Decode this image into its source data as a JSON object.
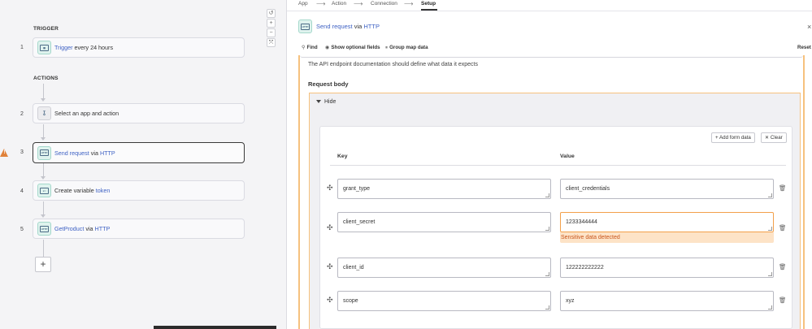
{
  "breadcrumbs": [
    "App",
    "Action",
    "Connection",
    "Setup"
  ],
  "flow": {
    "trigger_label": "TRIGGER",
    "actions_label": "ACTIONS",
    "steps": [
      {
        "num": "1",
        "prefix": "Trigger",
        "suffix": " every 24 hours",
        "icon": "calendar-icon"
      },
      {
        "num": "2",
        "prefix": "",
        "suffix": "Select an app and action",
        "icon": "action-icon"
      },
      {
        "num": "3",
        "prefix": "Send request",
        "suffix": " via ",
        "tail": "HTTP",
        "icon": "http-icon",
        "warning": true
      },
      {
        "num": "4",
        "prefix": "",
        "suffix": "Create variable ",
        "tail": "token",
        "icon": "variable-icon"
      },
      {
        "num": "5",
        "prefix": "GetProduct",
        "suffix": " via ",
        "tail": "HTTP",
        "icon": "http-icon"
      }
    ],
    "add_step": "+",
    "zoom_controls": [
      "↺",
      "+",
      "−",
      "⤧"
    ]
  },
  "panel": {
    "title_prefix": "Send request",
    "title_middle": " via ",
    "title_tail": "HTTP",
    "close": "×",
    "toolbar": {
      "find": "Find",
      "optional": "Show optional fields",
      "group": "Group map data",
      "reset": "Reset"
    },
    "hint": "The API endpoint documentation should define what data it expects",
    "section_title": "Request body",
    "hide_label": "Hide",
    "add_form_data": "Add form data",
    "clear": "Clear",
    "key_header": "Key",
    "value_header": "Value",
    "rows": [
      {
        "key": "grant_type",
        "value": "client_credentials"
      },
      {
        "key": "client_secret",
        "value": "1233344444",
        "warning": "Sensitive data detected"
      },
      {
        "key": "client_id",
        "value": "122222222222"
      },
      {
        "key": "scope",
        "value": "xyz"
      }
    ]
  },
  "colors": {
    "accent": "#3f62c4",
    "warning": "#f3a04a",
    "warning_text": "#c8551c"
  }
}
